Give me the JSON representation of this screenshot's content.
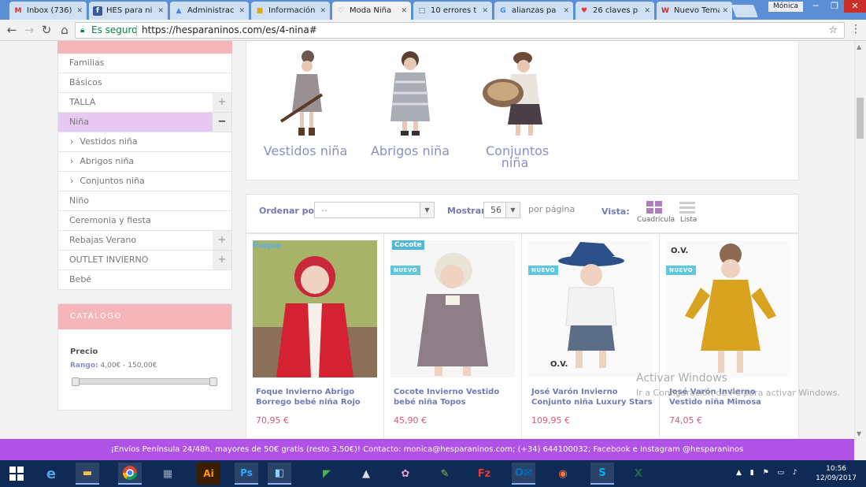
{
  "browser": {
    "tabs": [
      {
        "title": "Inbox (736)",
        "icon": "gmail-icon",
        "glyph": "M",
        "color": "#d93025"
      },
      {
        "title": "HES para ni",
        "icon": "facebook-icon",
        "glyph": "f",
        "color": "#3b5998"
      },
      {
        "title": "Administrac",
        "icon": "adwords-icon",
        "glyph": "▲",
        "color": "#4285f4"
      },
      {
        "title": "Información",
        "icon": "folder-icon",
        "glyph": "■",
        "color": "#e0a800"
      },
      {
        "title": "Moda Niña",
        "icon": "hesparaninos-icon",
        "glyph": "♡",
        "color": "#888"
      },
      {
        "title": "10 errores t",
        "icon": "document-icon",
        "glyph": "□",
        "color": "#666"
      },
      {
        "title": "alianzas pa",
        "icon": "google-icon",
        "glyph": "G",
        "color": "#4285f4"
      },
      {
        "title": "26 claves p",
        "icon": "heart-icon",
        "glyph": "♥",
        "color": "#e53935"
      },
      {
        "title": "Nuevo Tema",
        "icon": "w-icon",
        "glyph": "W",
        "color": "#c62828"
      }
    ],
    "profile": "Mónica",
    "secure_label": "Es seguro",
    "url": "https://hesparaninos.com/es/4-nina#"
  },
  "sidebar": {
    "items": [
      {
        "label": "Familias"
      },
      {
        "label": "Básicos"
      },
      {
        "label": "TALLA",
        "toggle": "+"
      },
      {
        "label": "Niña",
        "toggle": "−"
      },
      {
        "label": "Vestidos niña",
        "sub": true
      },
      {
        "label": "Abrigos niña",
        "sub": true
      },
      {
        "label": "Conjuntos niña",
        "sub": true
      },
      {
        "label": "Niño"
      },
      {
        "label": "Ceremonia y fiesta"
      },
      {
        "label": "Rebajas Verano",
        "toggle": "+"
      },
      {
        "label": "OUTLET INVIERNO",
        "toggle": "+"
      },
      {
        "label": "Bebé"
      }
    ],
    "catalog": {
      "title": "CATÁLOGO",
      "price_label": "Precio",
      "range_label": "Rango:",
      "range_value": "4,00€ - 150,00€"
    }
  },
  "subcategories": [
    {
      "label": "Vestidos niña"
    },
    {
      "label": "Abrigos niña"
    },
    {
      "label": "Conjuntos niña"
    }
  ],
  "sortbar": {
    "sort_label": "Ordenar por",
    "sort_value": "--",
    "show_label": "Mostrar",
    "show_value": "56",
    "per_page": "por página",
    "view_label": "Vista:",
    "grid_label": "Cuadrícula",
    "list_label": "Lista"
  },
  "products": [
    {
      "name": "Foque Invierno Abrigo Borrego bebé niña Rojo",
      "price": "70,95 €",
      "brand": "Foque",
      "badge": ""
    },
    {
      "name": "Cocote Invierno Vestido bebé niña Topos",
      "price": "45,90 €",
      "brand": "Cocote",
      "badge": "NUEVO"
    },
    {
      "name": "José Varón Invierno Conjunto niña Luxury Stars",
      "price": "109,95 €",
      "brand": "",
      "badge": "NUEVO"
    },
    {
      "name": "José Varón Invierno Vestido niña Mimosa",
      "price": "74,05 €",
      "brand": "",
      "badge": "NUEVO"
    }
  ],
  "watermark": {
    "line1": "Activar Windows",
    "line2": "Ir a Configuración de PC para activar Windows."
  },
  "announcement": "¡Envíos Península 24/48h, mayores de 50€ gratis (resto 3,50€)! Contacto: monica@hesparaninos.com; (+34) 644100032; Facebook e Instagram @hesparaninos",
  "taskbar": {
    "time": "10:56",
    "date": "12/09/2017"
  },
  "colors": {
    "accent_pink": "#f4b6b9",
    "link_blue": "#6f7bb5",
    "price_pink": "#d45b77",
    "announce_purple": "#b152e6",
    "badge_cyan": "#5fc8dd"
  }
}
